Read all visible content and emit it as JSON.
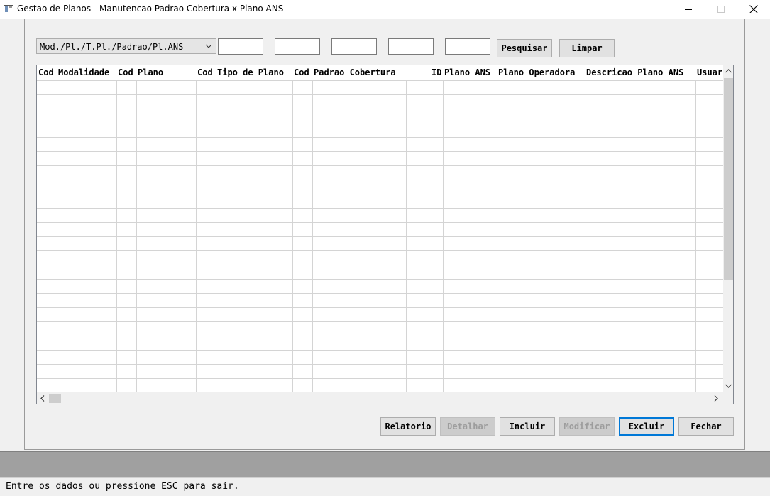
{
  "window": {
    "title": "Gestao de Planos - Manutencao Padrao Cobertura x Plano ANS"
  },
  "filter": {
    "combo_value": "Mod./Pl./T.Pl./Padrao/Pl.ANS",
    "fields": [
      "__",
      "__",
      "__",
      "__",
      "______"
    ],
    "search_label": "Pesquisar",
    "clear_label": "Limpar"
  },
  "grid": {
    "columns": [
      "Cod",
      "Modalidade",
      "Cod",
      "Plano",
      "Cod",
      "Tipo de Plano",
      "Cod",
      "Padrao Cobertura",
      "ID",
      "Plano ANS",
      "Plano Operadora",
      "Descricao Plano ANS",
      "Usuar"
    ],
    "rows": []
  },
  "actions": {
    "report": "Relatorio",
    "detail": "Detalhar",
    "include": "Incluir",
    "modify": "Modificar",
    "delete": "Excluir",
    "close": "Fechar"
  },
  "status": {
    "message": "Entre os dados ou pressione ESC para sair."
  }
}
